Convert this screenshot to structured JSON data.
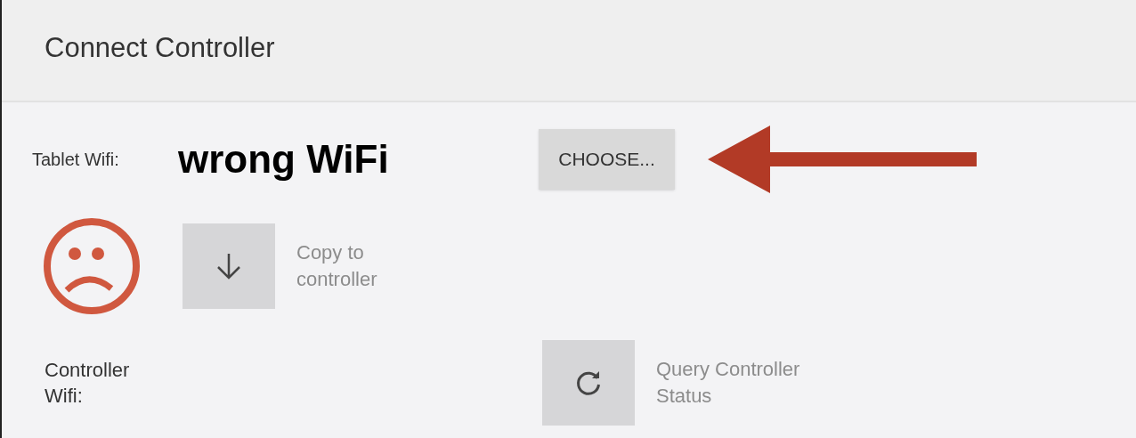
{
  "title": "Connect Controller",
  "tablet_wifi": {
    "label": "Tablet Wifi:",
    "button": "CHOOSE..."
  },
  "annotation": {
    "text": "wrong WiFi"
  },
  "status": {
    "kind": "sad"
  },
  "copy_action": {
    "label": "Copy to controller"
  },
  "controller_wifi": {
    "label": "Controller Wifi:"
  },
  "query_action": {
    "label": "Query Controller Status"
  }
}
